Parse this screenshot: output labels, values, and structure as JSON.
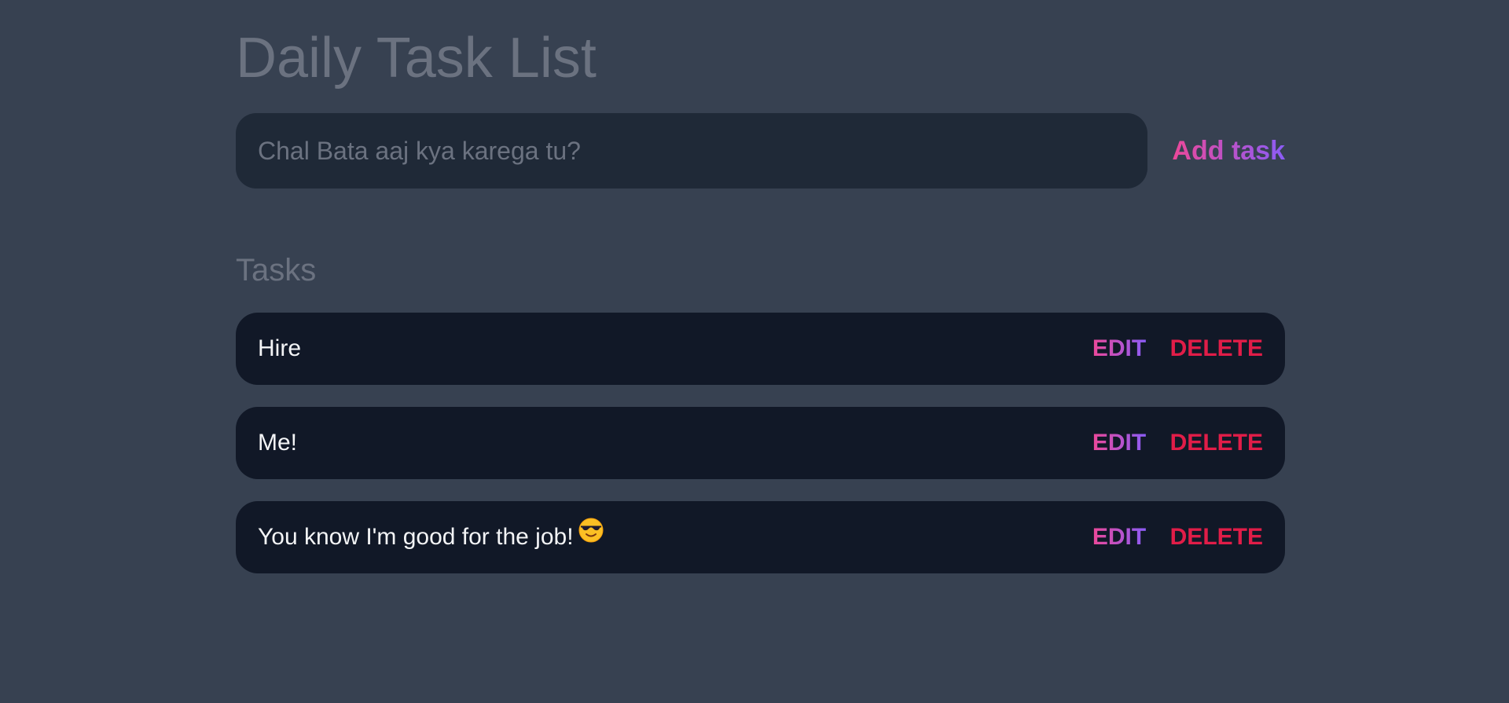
{
  "header": {
    "title": "Daily Task List"
  },
  "add_form": {
    "input_value": "",
    "input_placeholder": "Chal Bata aaj kya karega tu?",
    "add_label": "Add task"
  },
  "tasks_section": {
    "heading": "Tasks",
    "items": [
      {
        "text": "Hire",
        "emoji": "",
        "edit_label": "EDIT",
        "delete_label": "DELETE"
      },
      {
        "text": "Me!",
        "emoji": "",
        "edit_label": "EDIT",
        "delete_label": "DELETE"
      },
      {
        "text": "You know I'm good for the job!",
        "emoji": "smiling-face-with-sunglasses-icon",
        "edit_label": "EDIT",
        "delete_label": "DELETE"
      }
    ]
  },
  "colors": {
    "background": "#374151",
    "input_background": "#1f2937",
    "task_background": "#111827",
    "muted_text": "#6b7280",
    "gradient_start": "#ec4899",
    "gradient_end": "#8b5cf6",
    "delete": "#e11d48"
  }
}
